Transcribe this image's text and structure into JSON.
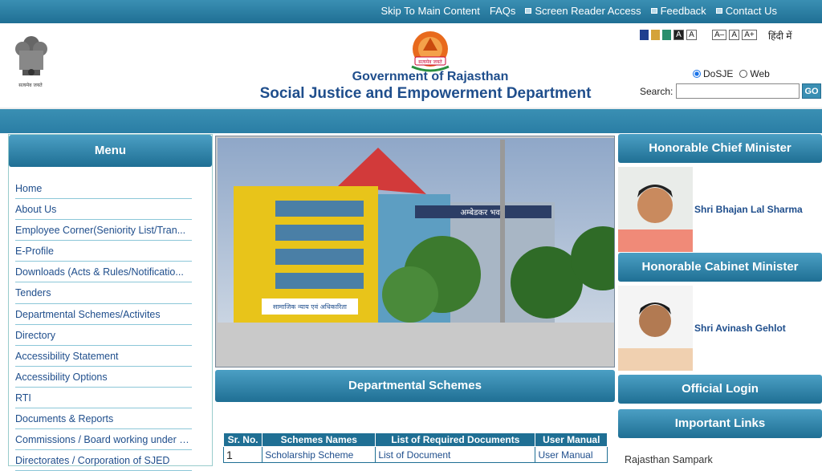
{
  "top_links": [
    {
      "label": "Skip To Main Content",
      "icon": ""
    },
    {
      "label": "FAQs",
      "icon": ""
    },
    {
      "label": "Screen Reader Access",
      "icon": "screen-reader-icon"
    },
    {
      "label": "Feedback",
      "icon": "feedback-icon"
    },
    {
      "label": "Contact Us",
      "icon": "contact-icon"
    }
  ],
  "header": {
    "emblem_caption": "सत्यमेव जयते",
    "logo_text": "सत्यमेव जयते",
    "government": "Government of Rajasthan",
    "department": "Social Justice and Empowerment Department"
  },
  "accessibility": {
    "theme_colors": [
      "#1f3f8f",
      "#d4a33a",
      "#2a8f6e"
    ],
    "contrast_labels": [
      "A",
      "A"
    ],
    "font_sizes": [
      "A–",
      "A",
      "A+"
    ],
    "language": "हिंदी में"
  },
  "search": {
    "options": [
      "DoSJE",
      "Web"
    ],
    "selected": "DoSJE",
    "label": "Search:",
    "value": "",
    "button": "GO"
  },
  "menu": {
    "title": "Menu",
    "items": [
      "Home",
      "About Us",
      "Employee Corner(Seniority List/Tran...",
      "E-Profile",
      "Downloads (Acts & Rules/Notificatio...",
      "Tenders",
      "Departmental Schemes/Activites",
      "Directory",
      "Accessibility Statement",
      "Accessibility Options",
      "RTI",
      "Documents & Reports",
      "Commissions / Board working under D...",
      "Directorates / Corporation of SJED"
    ]
  },
  "banner": {
    "building_sign": "अम्बेडकर भवन",
    "board_text": "सामाजिक न्याय एवं अधिकारिता"
  },
  "schemes": {
    "title": "Departmental Schemes",
    "columns": [
      "Sr. No.",
      "Schemes Names",
      "List of Required Documents",
      "User Manual"
    ],
    "rows": [
      {
        "sr": "1",
        "name": "Scholarship Scheme",
        "docs": "List of Document",
        "manual": "User Manual"
      }
    ]
  },
  "right": {
    "cm_title": "Honorable Chief Minister",
    "cm_name": "Shri Bhajan Lal Sharma",
    "cabinet_title": "Honorable Cabinet Minister",
    "cabinet_name": "Shri Avinash Gehlot",
    "login_title": "Official Login",
    "links_title": "Important Links",
    "links": [
      "Rajasthan Sampark"
    ]
  },
  "colors": {
    "primary": "#1f6f94",
    "accent": "#3a8fb3",
    "text_link": "#1f4e8c"
  }
}
